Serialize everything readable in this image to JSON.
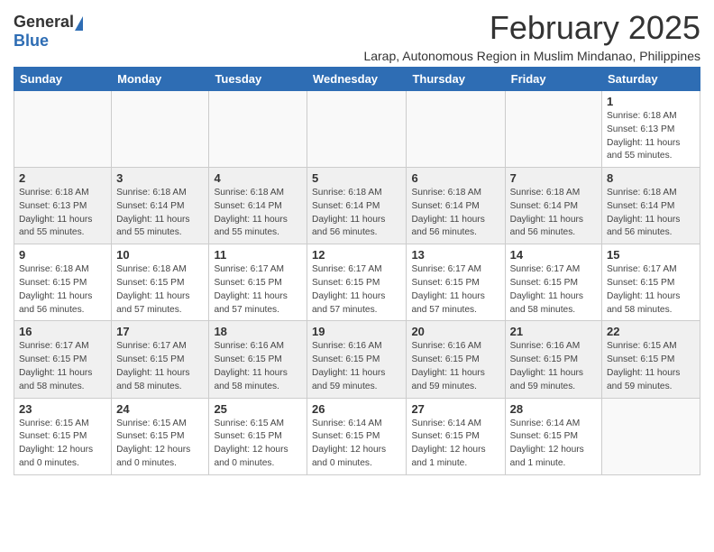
{
  "header": {
    "logo_general": "General",
    "logo_blue": "Blue",
    "title": "February 2025",
    "subtitle": "Larap, Autonomous Region in Muslim Mindanao, Philippines"
  },
  "days_of_week": [
    "Sunday",
    "Monday",
    "Tuesday",
    "Wednesday",
    "Thursday",
    "Friday",
    "Saturday"
  ],
  "weeks": [
    {
      "shaded": false,
      "days": [
        {
          "date": "",
          "info": ""
        },
        {
          "date": "",
          "info": ""
        },
        {
          "date": "",
          "info": ""
        },
        {
          "date": "",
          "info": ""
        },
        {
          "date": "",
          "info": ""
        },
        {
          "date": "",
          "info": ""
        },
        {
          "date": "1",
          "info": "Sunrise: 6:18 AM\nSunset: 6:13 PM\nDaylight: 11 hours\nand 55 minutes."
        }
      ]
    },
    {
      "shaded": true,
      "days": [
        {
          "date": "2",
          "info": "Sunrise: 6:18 AM\nSunset: 6:13 PM\nDaylight: 11 hours\nand 55 minutes."
        },
        {
          "date": "3",
          "info": "Sunrise: 6:18 AM\nSunset: 6:14 PM\nDaylight: 11 hours\nand 55 minutes."
        },
        {
          "date": "4",
          "info": "Sunrise: 6:18 AM\nSunset: 6:14 PM\nDaylight: 11 hours\nand 55 minutes."
        },
        {
          "date": "5",
          "info": "Sunrise: 6:18 AM\nSunset: 6:14 PM\nDaylight: 11 hours\nand 56 minutes."
        },
        {
          "date": "6",
          "info": "Sunrise: 6:18 AM\nSunset: 6:14 PM\nDaylight: 11 hours\nand 56 minutes."
        },
        {
          "date": "7",
          "info": "Sunrise: 6:18 AM\nSunset: 6:14 PM\nDaylight: 11 hours\nand 56 minutes."
        },
        {
          "date": "8",
          "info": "Sunrise: 6:18 AM\nSunset: 6:14 PM\nDaylight: 11 hours\nand 56 minutes."
        }
      ]
    },
    {
      "shaded": false,
      "days": [
        {
          "date": "9",
          "info": "Sunrise: 6:18 AM\nSunset: 6:15 PM\nDaylight: 11 hours\nand 56 minutes."
        },
        {
          "date": "10",
          "info": "Sunrise: 6:18 AM\nSunset: 6:15 PM\nDaylight: 11 hours\nand 57 minutes."
        },
        {
          "date": "11",
          "info": "Sunrise: 6:17 AM\nSunset: 6:15 PM\nDaylight: 11 hours\nand 57 minutes."
        },
        {
          "date": "12",
          "info": "Sunrise: 6:17 AM\nSunset: 6:15 PM\nDaylight: 11 hours\nand 57 minutes."
        },
        {
          "date": "13",
          "info": "Sunrise: 6:17 AM\nSunset: 6:15 PM\nDaylight: 11 hours\nand 57 minutes."
        },
        {
          "date": "14",
          "info": "Sunrise: 6:17 AM\nSunset: 6:15 PM\nDaylight: 11 hours\nand 58 minutes."
        },
        {
          "date": "15",
          "info": "Sunrise: 6:17 AM\nSunset: 6:15 PM\nDaylight: 11 hours\nand 58 minutes."
        }
      ]
    },
    {
      "shaded": true,
      "days": [
        {
          "date": "16",
          "info": "Sunrise: 6:17 AM\nSunset: 6:15 PM\nDaylight: 11 hours\nand 58 minutes."
        },
        {
          "date": "17",
          "info": "Sunrise: 6:17 AM\nSunset: 6:15 PM\nDaylight: 11 hours\nand 58 minutes."
        },
        {
          "date": "18",
          "info": "Sunrise: 6:16 AM\nSunset: 6:15 PM\nDaylight: 11 hours\nand 58 minutes."
        },
        {
          "date": "19",
          "info": "Sunrise: 6:16 AM\nSunset: 6:15 PM\nDaylight: 11 hours\nand 59 minutes."
        },
        {
          "date": "20",
          "info": "Sunrise: 6:16 AM\nSunset: 6:15 PM\nDaylight: 11 hours\nand 59 minutes."
        },
        {
          "date": "21",
          "info": "Sunrise: 6:16 AM\nSunset: 6:15 PM\nDaylight: 11 hours\nand 59 minutes."
        },
        {
          "date": "22",
          "info": "Sunrise: 6:15 AM\nSunset: 6:15 PM\nDaylight: 11 hours\nand 59 minutes."
        }
      ]
    },
    {
      "shaded": false,
      "days": [
        {
          "date": "23",
          "info": "Sunrise: 6:15 AM\nSunset: 6:15 PM\nDaylight: 12 hours\nand 0 minutes."
        },
        {
          "date": "24",
          "info": "Sunrise: 6:15 AM\nSunset: 6:15 PM\nDaylight: 12 hours\nand 0 minutes."
        },
        {
          "date": "25",
          "info": "Sunrise: 6:15 AM\nSunset: 6:15 PM\nDaylight: 12 hours\nand 0 minutes."
        },
        {
          "date": "26",
          "info": "Sunrise: 6:14 AM\nSunset: 6:15 PM\nDaylight: 12 hours\nand 0 minutes."
        },
        {
          "date": "27",
          "info": "Sunrise: 6:14 AM\nSunset: 6:15 PM\nDaylight: 12 hours\nand 1 minute."
        },
        {
          "date": "28",
          "info": "Sunrise: 6:14 AM\nSunset: 6:15 PM\nDaylight: 12 hours\nand 1 minute."
        },
        {
          "date": "",
          "info": ""
        }
      ]
    }
  ]
}
